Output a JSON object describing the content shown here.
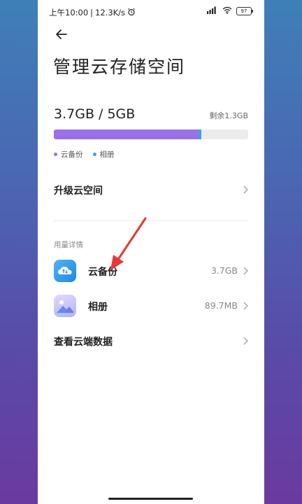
{
  "status_bar": {
    "time": "上午10:00",
    "separator": "|",
    "speed": "12.3K/s",
    "battery": "97"
  },
  "header": {
    "title": "管理云存储空间"
  },
  "storage": {
    "used": "3.7GB",
    "total": "5GB",
    "usage_text": "3.7GB / 5GB",
    "remaining": "剩余1.3GB",
    "cloud_backup_fraction": 0.74,
    "album_fraction": 0.018,
    "colors": {
      "cloud_backup": "#9b6fe6",
      "album": "#4a9be6",
      "track": "#ececec"
    },
    "legend": [
      {
        "label": "云备份",
        "color": "#9b6fe6"
      },
      {
        "label": "相册",
        "color": "#4a9be6"
      }
    ]
  },
  "upgrade": {
    "label": "升级云空间"
  },
  "usage_details": {
    "section_label": "用量详情",
    "items": [
      {
        "label": "云备份",
        "value": "3.7GB",
        "icon": "cloud-backup-icon"
      },
      {
        "label": "相册",
        "value": "89.7MB",
        "icon": "gallery-icon"
      }
    ]
  },
  "view_cloud_data": {
    "label": "查看云端数据"
  },
  "annotation": {
    "arrow_color": "#e53935"
  }
}
